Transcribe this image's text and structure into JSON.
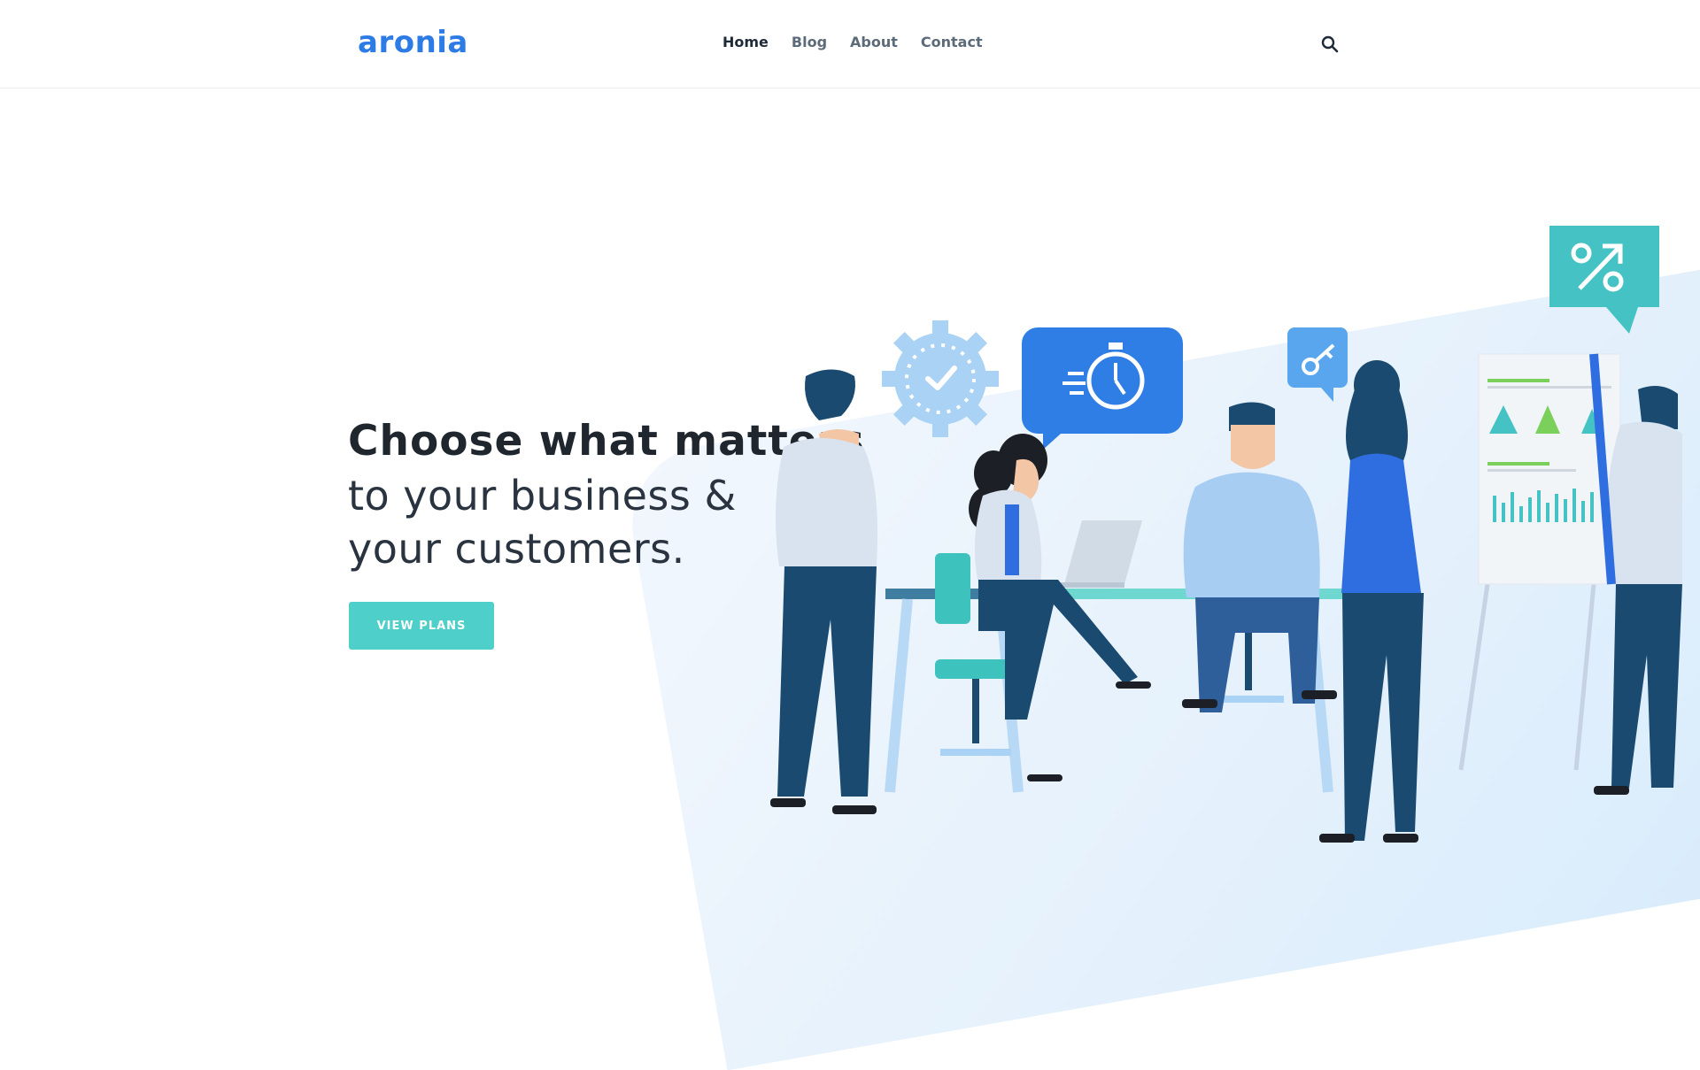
{
  "header": {
    "logo": "aronia",
    "nav": [
      {
        "label": "Home",
        "active": true
      },
      {
        "label": "Blog",
        "active": false
      },
      {
        "label": "About",
        "active": false
      },
      {
        "label": "Contact",
        "active": false
      }
    ],
    "search_icon": "search-icon"
  },
  "hero": {
    "headline_bold": "Choose what matters",
    "headline_line2": "to your business &",
    "headline_line3": "your customers.",
    "cta_label": "VIEW PLANS"
  },
  "colors": {
    "brand": "#2d7be5",
    "accent": "#4fcfc9",
    "navy": "#1a4a70"
  },
  "illustration": {
    "icons": [
      "gear-icon",
      "stopwatch-icon",
      "key-icon",
      "percent-icon"
    ]
  }
}
